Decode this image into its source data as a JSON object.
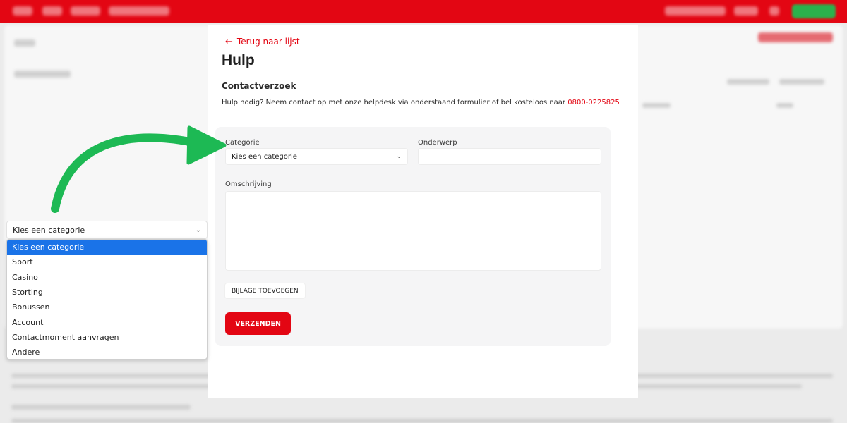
{
  "modal": {
    "back_link": "Terug naar lijst",
    "title": "Hulp",
    "section_title": "Contactverzoek",
    "help_text": "Hulp nodig? Neem contact op met onze helpdesk via onderstaand formulier of bel kosteloos naar ",
    "phone": "0800-0225825"
  },
  "form": {
    "category_label": "Categorie",
    "category_value": "Kies een categorie",
    "subject_label": "Onderwerp",
    "subject_value": "",
    "description_label": "Omschrijving",
    "attach_button": "BIJLAGE TOEVOEGEN",
    "submit_button": "VERZENDEN"
  },
  "dropdown": {
    "selected": "Kies een categorie",
    "options": [
      "Kies een categorie",
      "Sport",
      "Casino",
      "Storting",
      "Bonussen",
      "Account",
      "Contactmoment aanvragen",
      "Andere"
    ]
  },
  "colors": {
    "brand_red": "#e30613",
    "arrow_green": "#1db954",
    "selected_blue": "#1a73e8"
  },
  "icons": [
    "arrow-left-icon",
    "chevron-down-icon",
    "curved-arrow-icon"
  ]
}
